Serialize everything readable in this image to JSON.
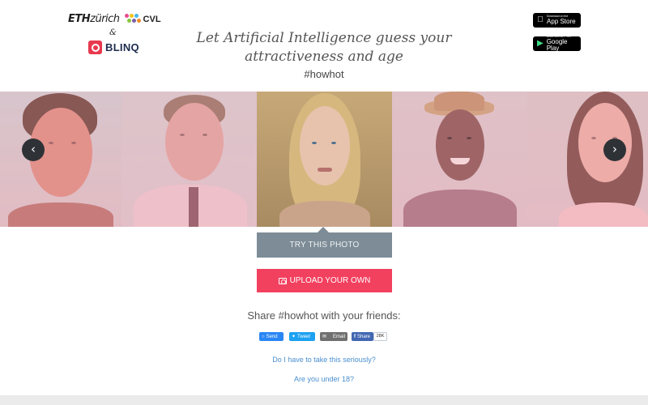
{
  "header": {
    "logos": {
      "eth_bold": "ETH",
      "eth_light": "zürich",
      "cvl": "CVL",
      "ampersand": "&",
      "blinq": "BLINQ"
    },
    "headline": "Let Artificial Intelligence guess your attractiveness and age",
    "tagline": "#howhot",
    "app_store": {
      "small": "Download on the",
      "big": "App Store",
      "icon": "apple-icon"
    },
    "google_play": {
      "small": "ANDROID APP ON",
      "big": "Google Play",
      "icon": "play-icon"
    }
  },
  "carousel": {
    "prev_icon": "‹",
    "next_icon": "›",
    "selected_index": 2
  },
  "actions": {
    "try_label": "TRY THIS PHOTO",
    "upload_label": "UPLOAD YOUR OWN",
    "upload_icon": "camera-icon"
  },
  "share": {
    "title": "Share #howhot with your friends:",
    "messenger": "Send",
    "twitter": "Tweet",
    "email": "Email",
    "facebook": "Share",
    "facebook_count": "28K"
  },
  "links": {
    "serious": "Do I have to take this seriously?",
    "under18": "Are you under 18?"
  },
  "colors": {
    "accent_pink": "#f2405f",
    "try_gray": "#7d8c96",
    "link_blue": "#4a8fd0"
  }
}
